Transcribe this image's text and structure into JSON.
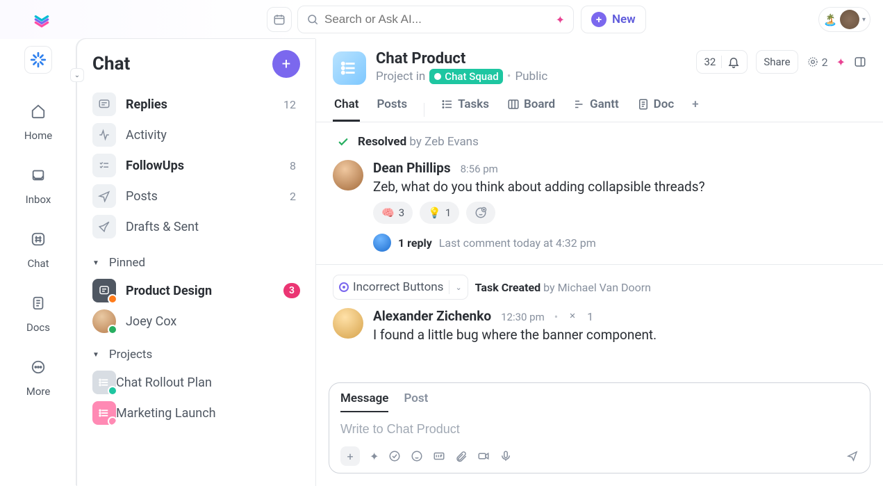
{
  "topbar": {
    "search_placeholder": "Search or Ask AI...",
    "new_label": "New"
  },
  "rail": {
    "items": [
      {
        "label": ""
      },
      {
        "label": "Home"
      },
      {
        "label": "Inbox"
      },
      {
        "label": "Chat"
      },
      {
        "label": "Docs"
      },
      {
        "label": "More"
      }
    ]
  },
  "mid": {
    "title": "Chat",
    "nav": [
      {
        "label": "Replies",
        "count": "12",
        "bold": true
      },
      {
        "label": "Activity",
        "count": "",
        "bold": false
      },
      {
        "label": "FollowUps",
        "count": "8",
        "bold": true
      },
      {
        "label": "Posts",
        "count": "2",
        "bold": false
      },
      {
        "label": "Drafts & Sent",
        "count": "",
        "bold": false
      }
    ],
    "pinned_header": "Pinned",
    "pinned": [
      {
        "label": "Product Design",
        "badge": "3"
      },
      {
        "label": "Joey Cox"
      }
    ],
    "projects_header": "Projects",
    "projects": [
      {
        "label": "Chat Rollout Plan"
      },
      {
        "label": "Marketing Launch"
      }
    ]
  },
  "header": {
    "title": "Chat Product",
    "project_in": "Project in",
    "squad": "Chat Squad",
    "visibility": "Public",
    "count": "32",
    "share": "Share",
    "ai_count": "2",
    "tabs": [
      "Chat",
      "Posts",
      "Tasks",
      "Board",
      "Gantt",
      "Doc"
    ]
  },
  "feed": {
    "resolved_label": "Resolved",
    "resolved_by_prefix": "by ",
    "resolved_by": "Zeb Evans",
    "msg1": {
      "name": "Dean Phillips",
      "time": "8:56 pm",
      "text": "Zeb, what do you think about adding collapsible threads?",
      "reactions": [
        {
          "emoji": "🧠",
          "count": "3"
        },
        {
          "emoji": "💡",
          "count": "1"
        }
      ],
      "reply_count": "1 reply",
      "reply_meta": "Last comment today at 4:32 pm"
    },
    "task_chip": "Incorrect Buttons",
    "task_created": "Task Created",
    "task_by_prefix": "by ",
    "task_by": "Michael Van Doorn",
    "msg2": {
      "name": "Alexander Zichenko",
      "time": "12:30 pm",
      "thread_cnt": "1",
      "text": "I found a little bug where the banner component."
    }
  },
  "composer": {
    "tab_message": "Message",
    "tab_post": "Post",
    "placeholder": "Write to Chat Product"
  }
}
